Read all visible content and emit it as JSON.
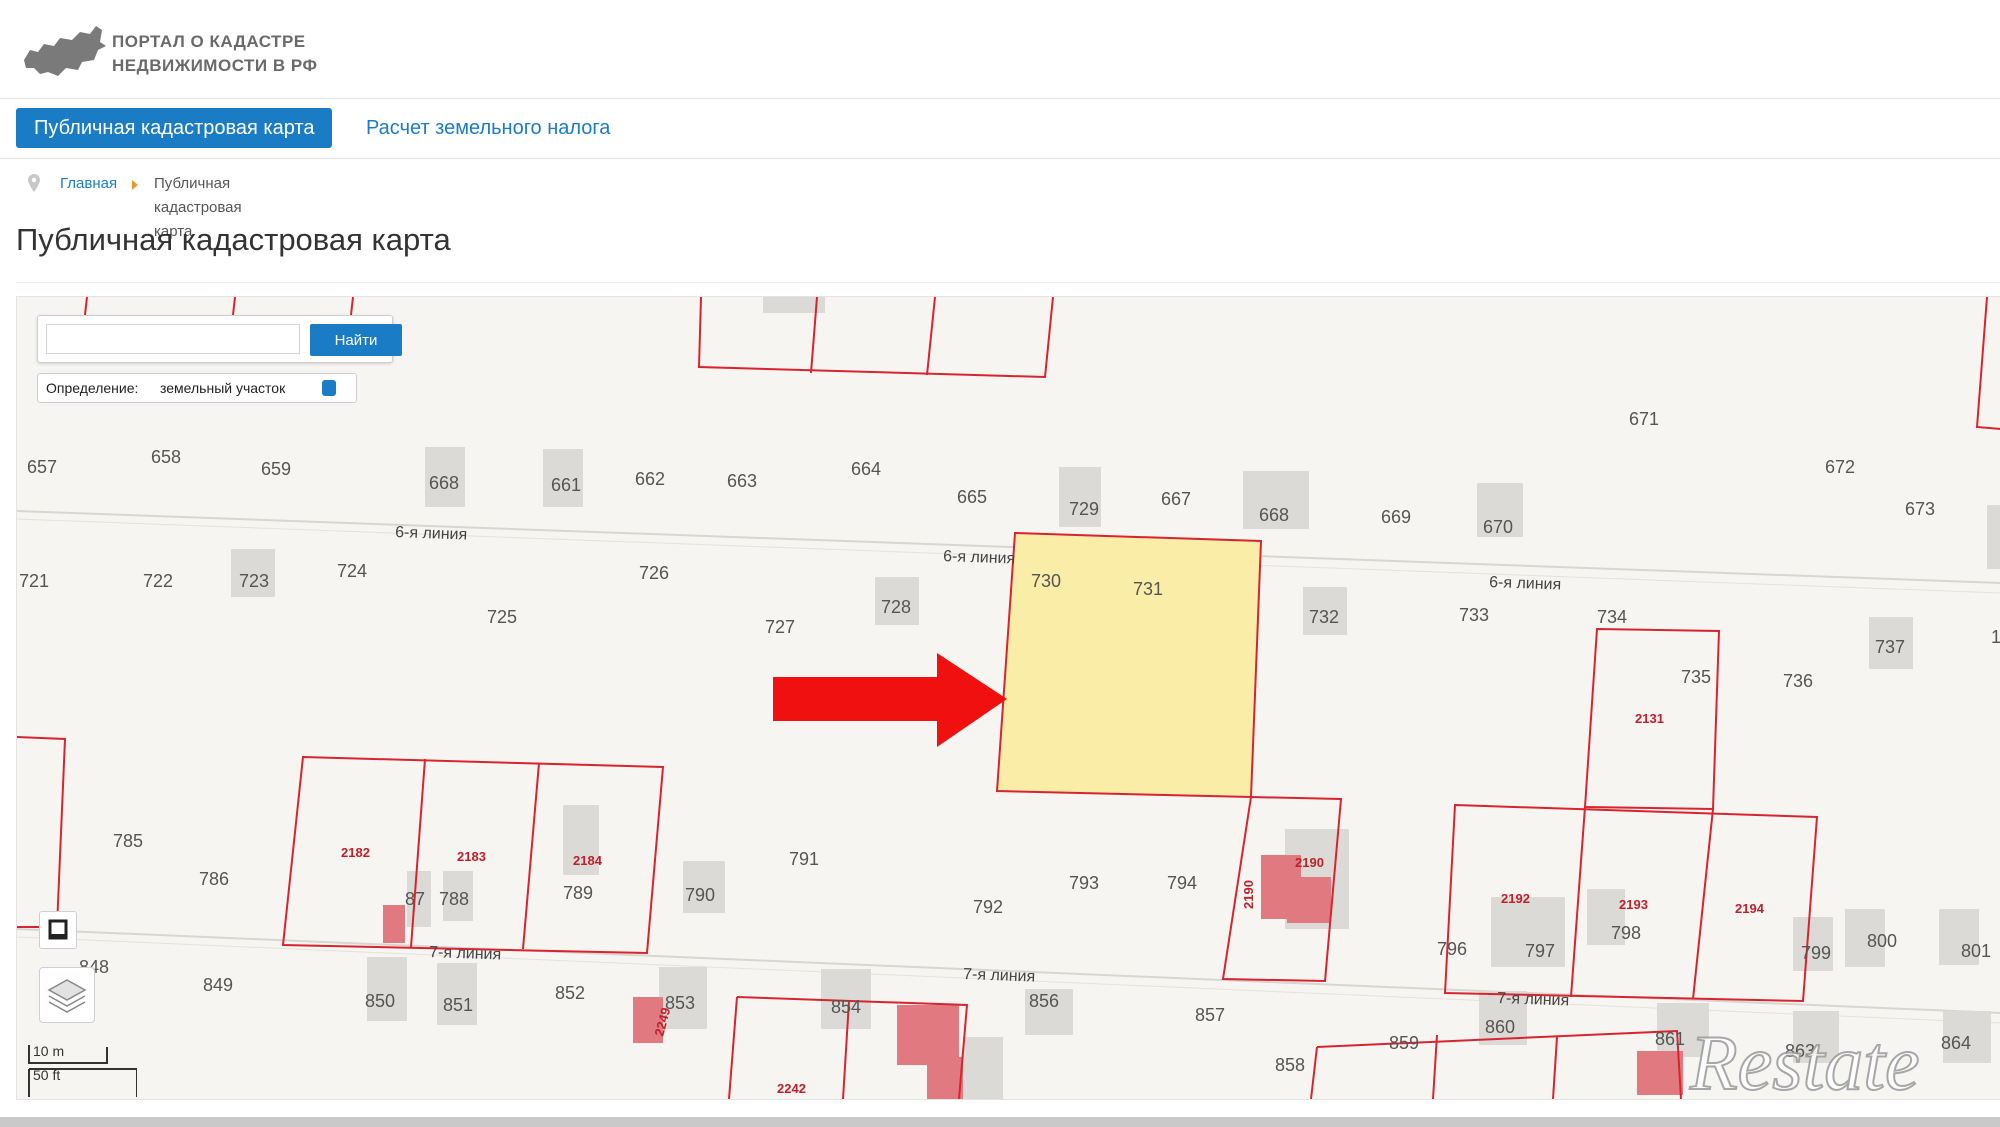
{
  "header": {
    "logo_icon": "russia-map-icon",
    "logo_line1": "ПОРТАЛ О КАДАСТРЕ",
    "logo_line2": "НЕДВИЖИМОСТИ В РФ"
  },
  "nav": {
    "active_tab": "Публичная кадастровая карта",
    "second_tab": "Расчет земельного налога"
  },
  "breadcrumb": {
    "home": "Главная",
    "current": "Публичная кадастровая карта"
  },
  "page_title": "Публичная кадастровая карта",
  "map": {
    "search_placeholder": "",
    "search_button": "Найти",
    "definition_label": "Определение:",
    "definition_value": "земельный участок",
    "scale_m": "10 m",
    "scale_ft": "50 ft",
    "highlight_color": "#f9eda8",
    "boundary_color": "#d8242f",
    "arrow_color": "#f01010",
    "streets": [
      "6-я линия",
      "6-я линия",
      "6-я линия",
      "7-я линия",
      "7-я линия",
      "7-я линия"
    ],
    "parcel_labels": [
      "657",
      "658",
      "659",
      "668",
      "661",
      "662",
      "663",
      "664",
      "665",
      "729",
      "667",
      "668",
      "669",
      "670",
      "671",
      "672",
      "673",
      "721",
      "722",
      "723",
      "724",
      "725",
      "726",
      "727",
      "728",
      "730",
      "731",
      "732",
      "733",
      "734",
      "735",
      "736",
      "737",
      "785",
      "786",
      "87",
      "788",
      "789",
      "790",
      "791",
      "792",
      "793",
      "794",
      "796",
      "797",
      "798",
      "799",
      "800",
      "801",
      "848",
      "849",
      "850",
      "851",
      "852",
      "853",
      "854",
      "856",
      "857",
      "858",
      "859",
      "860",
      "861",
      "863",
      "864",
      "1"
    ],
    "cadastral_labels": [
      "2182",
      "2183",
      "2184",
      "2190",
      "2190",
      "2131",
      "2192",
      "2193",
      "2194",
      "2242",
      "2249"
    ]
  },
  "watermark": "Restate"
}
